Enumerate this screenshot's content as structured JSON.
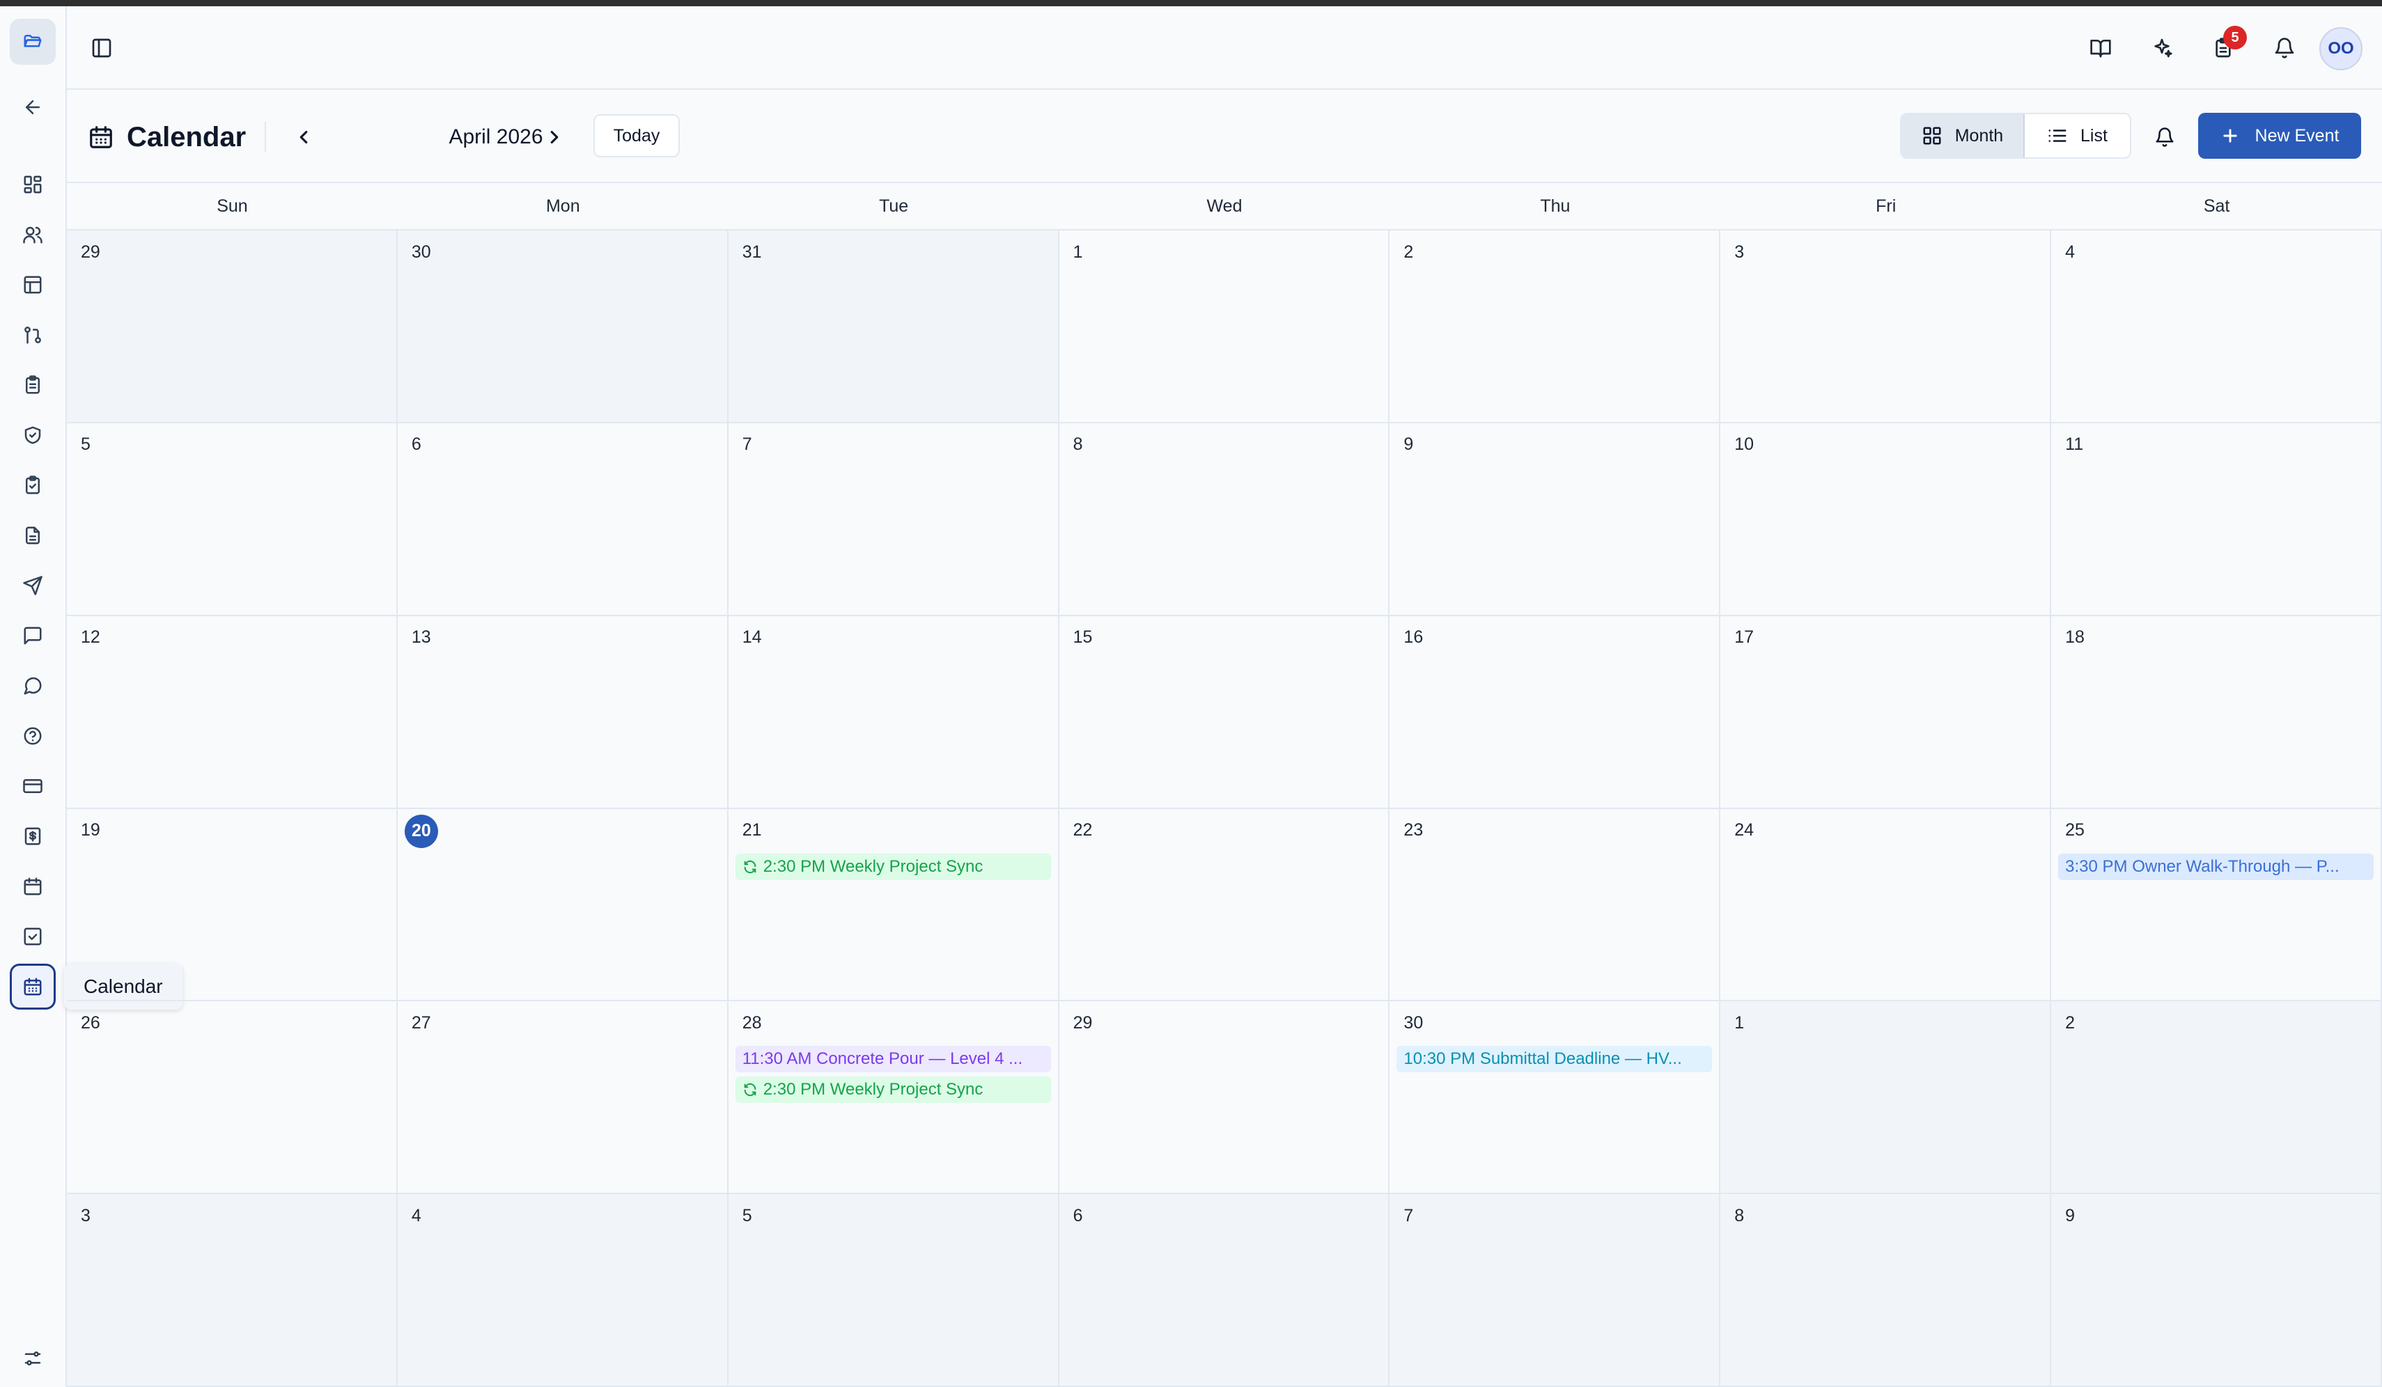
{
  "sidebar": {
    "tooltip": "Calendar"
  },
  "header": {
    "notifications_badge": "5",
    "avatar_initials": "OO"
  },
  "toolbar": {
    "title": "Calendar",
    "month_label": "April 2026",
    "today_label": "Today",
    "month_view_label": "Month",
    "list_view_label": "List",
    "new_event_label": "New Event"
  },
  "weekdays": [
    "Sun",
    "Mon",
    "Tue",
    "Wed",
    "Thu",
    "Fri",
    "Sat"
  ],
  "weeks": [
    [
      {
        "day": "29",
        "outside": true
      },
      {
        "day": "30",
        "outside": true
      },
      {
        "day": "31",
        "outside": true
      },
      {
        "day": "1"
      },
      {
        "day": "2"
      },
      {
        "day": "3"
      },
      {
        "day": "4"
      }
    ],
    [
      {
        "day": "5"
      },
      {
        "day": "6"
      },
      {
        "day": "7"
      },
      {
        "day": "8"
      },
      {
        "day": "9"
      },
      {
        "day": "10"
      },
      {
        "day": "11"
      }
    ],
    [
      {
        "day": "12"
      },
      {
        "day": "13"
      },
      {
        "day": "14"
      },
      {
        "day": "15"
      },
      {
        "day": "16"
      },
      {
        "day": "17"
      },
      {
        "day": "18"
      }
    ],
    [
      {
        "day": "19"
      },
      {
        "day": "20",
        "today": true
      },
      {
        "day": "21",
        "events": [
          {
            "text": "2:30 PM Weekly Project Sync",
            "color": "green",
            "recurring": true
          }
        ]
      },
      {
        "day": "22"
      },
      {
        "day": "23"
      },
      {
        "day": "24"
      },
      {
        "day": "25",
        "events": [
          {
            "text": "3:30 PM Owner Walk-Through — P...",
            "color": "blue"
          }
        ]
      }
    ],
    [
      {
        "day": "26"
      },
      {
        "day": "27"
      },
      {
        "day": "28",
        "events": [
          {
            "text": "11:30 AM Concrete Pour — Level 4 ...",
            "color": "purple"
          },
          {
            "text": "2:30 PM Weekly Project Sync",
            "color": "green",
            "recurring": true
          }
        ]
      },
      {
        "day": "29"
      },
      {
        "day": "30",
        "events": [
          {
            "text": "10:30 PM Submittal Deadline — HV...",
            "color": "cyan"
          }
        ]
      },
      {
        "day": "1",
        "outside": true
      },
      {
        "day": "2",
        "outside": true
      }
    ],
    [
      {
        "day": "3",
        "outside": true
      },
      {
        "day": "4",
        "outside": true
      },
      {
        "day": "5",
        "outside": true
      },
      {
        "day": "6",
        "outside": true
      },
      {
        "day": "7",
        "outside": true
      },
      {
        "day": "8",
        "outside": true
      },
      {
        "day": "9",
        "outside": true
      }
    ]
  ],
  "colors": {
    "primary": "#2a5bb8",
    "badge": "#dc2626",
    "event_green": "#16a34a",
    "event_blue": "#3b6fd6",
    "event_purple": "#7c3aed",
    "event_cyan": "#0891b2"
  }
}
